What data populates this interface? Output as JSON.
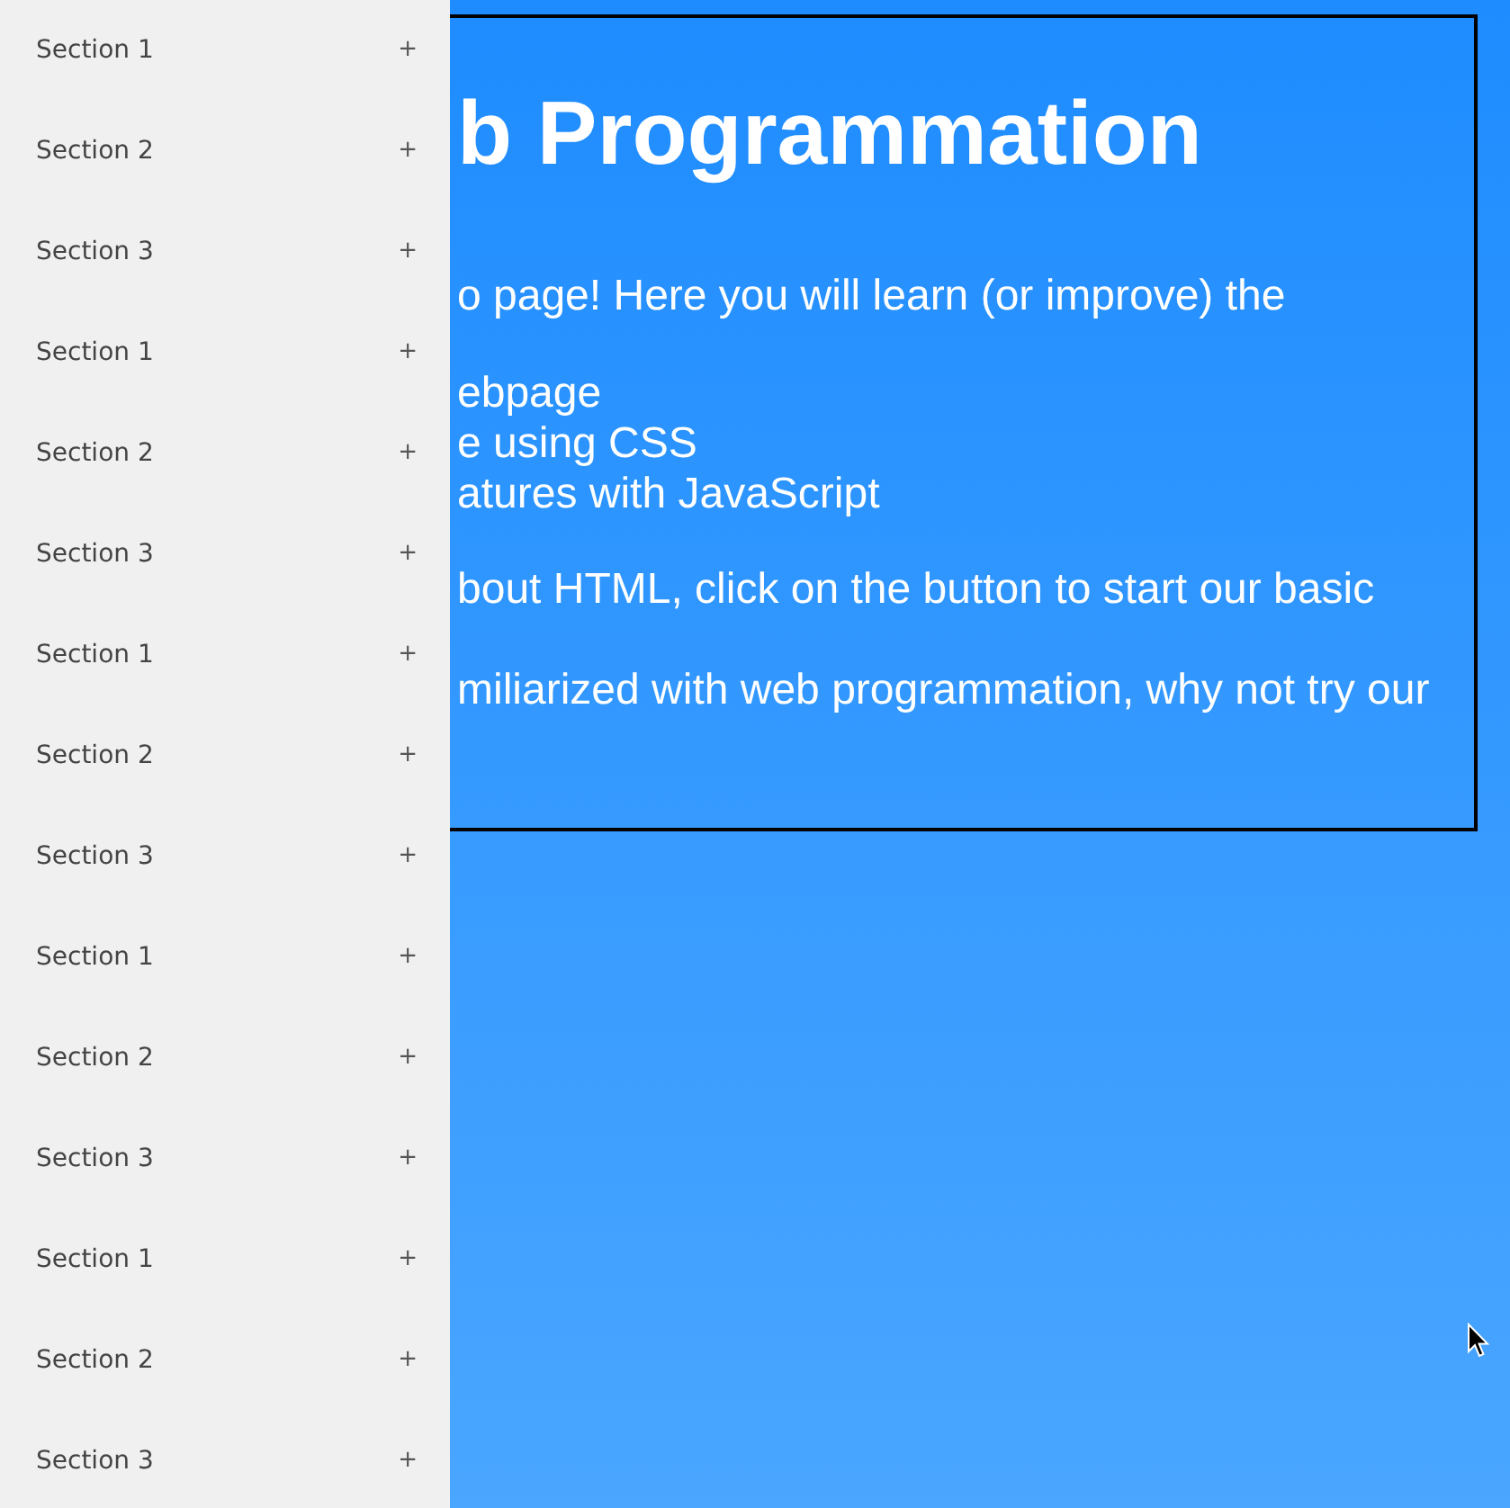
{
  "sidebar": {
    "items": [
      {
        "label": "Section 1",
        "toggle": "+"
      },
      {
        "label": "Section 2",
        "toggle": "+"
      },
      {
        "label": "Section 3",
        "toggle": "+"
      },
      {
        "label": "Section 1",
        "toggle": "+"
      },
      {
        "label": "Section 2",
        "toggle": "+"
      },
      {
        "label": "Section 3",
        "toggle": "+"
      },
      {
        "label": "Section 1",
        "toggle": "+"
      },
      {
        "label": "Section 2",
        "toggle": "+"
      },
      {
        "label": "Section 3",
        "toggle": "+"
      },
      {
        "label": "Section 1",
        "toggle": "+"
      },
      {
        "label": "Section 2",
        "toggle": "+"
      },
      {
        "label": "Section 3",
        "toggle": "+"
      },
      {
        "label": "Section 1",
        "toggle": "+"
      },
      {
        "label": "Section 2",
        "toggle": "+"
      },
      {
        "label": "Section 3",
        "toggle": "+"
      }
    ]
  },
  "main": {
    "title": "b Programmation",
    "blocks": [
      {
        "kind": "paragraph",
        "text": "o page! Here you will learn (or improve) the"
      },
      {
        "kind": "list",
        "items": [
          "ebpage",
          "e using CSS",
          "atures with JavaScript"
        ]
      },
      {
        "kind": "paragraph",
        "text": "bout HTML, click on the button to start our basic"
      },
      {
        "kind": "paragraph",
        "text": "miliarized with web programmation, why not try our"
      }
    ]
  }
}
